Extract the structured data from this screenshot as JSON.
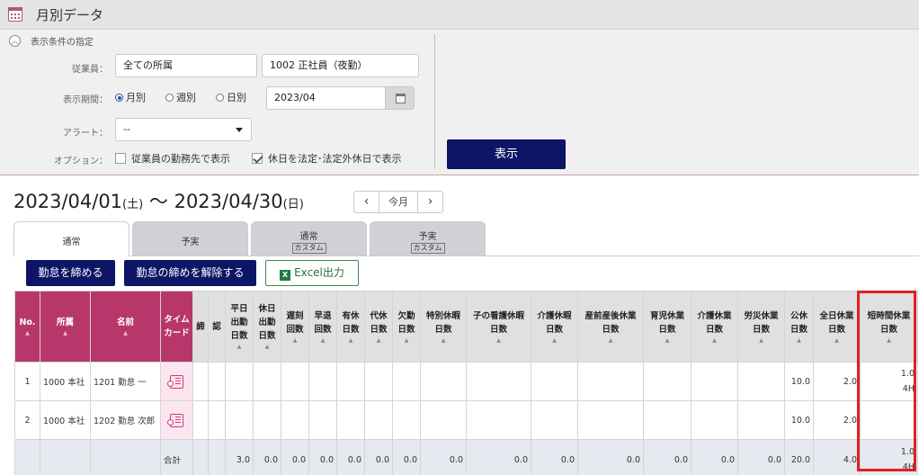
{
  "window": {
    "title": "月別データ"
  },
  "conditions": {
    "header": "表示条件の指定",
    "employee_label": "従業員：",
    "employee_dept": "全ての所属",
    "employee_name": "1002 正社員（夜勤）",
    "period_label": "表示期間：",
    "period_options": [
      "月別",
      "週別",
      "日別"
    ],
    "period_selected": "月別",
    "period_value": "2023/04",
    "alert_label": "アラート：",
    "alert_value": "--",
    "option_label": "オプション：",
    "option1": "従業員の勤務先で表示",
    "option1_checked": false,
    "option2": "休日を法定･法定外休日で表示",
    "option2_checked": true,
    "show_button": "表示"
  },
  "range": {
    "start": "2023/04/01",
    "start_day": "(土)",
    "sep": "〜",
    "end": "2023/04/30",
    "end_day": "(日)",
    "this_month": "今月",
    "prev": "‹",
    "next": "›"
  },
  "tabs": [
    {
      "label": "通常",
      "sub": "",
      "active": true
    },
    {
      "label": "予実",
      "sub": "",
      "active": false
    },
    {
      "label": "通常",
      "sub": "カスタム",
      "active": false
    },
    {
      "label": "予実",
      "sub": "カスタム",
      "active": false
    }
  ],
  "actions": {
    "close": "勤怠を締める",
    "unclose": "勤怠の締めを解除する",
    "excel": "Excel出力",
    "excel_icon": "X"
  },
  "table": {
    "columns": [
      {
        "name": "No.",
        "lines": [
          "No."
        ],
        "sort": true,
        "pink": true
      },
      {
        "name": "所属",
        "lines": [
          "所属"
        ],
        "sort": true,
        "pink": true
      },
      {
        "name": "名前",
        "lines": [
          "名前"
        ],
        "sort": true,
        "pink": true
      },
      {
        "name": "タイムカード",
        "lines": [
          "タイム",
          "カード"
        ],
        "sort": false,
        "pink": true
      },
      {
        "name": "締",
        "lines": [
          "締"
        ],
        "sort": false
      },
      {
        "name": "認",
        "lines": [
          "認"
        ],
        "sort": false
      },
      {
        "name": "平日出勤日数",
        "lines": [
          "平日",
          "出勤",
          "日数"
        ],
        "sort": true
      },
      {
        "name": "休日出勤日数",
        "lines": [
          "休日",
          "出勤",
          "日数"
        ],
        "sort": true
      },
      {
        "name": "遅刻回数",
        "lines": [
          "遅刻",
          "回数"
        ],
        "sort": true
      },
      {
        "name": "早退回数",
        "lines": [
          "早退",
          "回数"
        ],
        "sort": true
      },
      {
        "name": "有休日数",
        "lines": [
          "有休",
          "日数"
        ],
        "sort": true
      },
      {
        "name": "代休日数",
        "lines": [
          "代休",
          "日数"
        ],
        "sort": true
      },
      {
        "name": "欠勤日数",
        "lines": [
          "欠勤",
          "日数"
        ],
        "sort": true
      },
      {
        "name": "特別休暇日数",
        "lines": [
          "特別休暇",
          "日数"
        ],
        "sort": true
      },
      {
        "name": "子の看護休暇日数",
        "lines": [
          "子の看護休暇",
          "日数"
        ],
        "sort": true
      },
      {
        "name": "介護休暇日数",
        "lines": [
          "介護休暇",
          "日数"
        ],
        "sort": true
      },
      {
        "name": "産前産後休業日数",
        "lines": [
          "産前産後休業",
          "日数"
        ],
        "sort": true
      },
      {
        "name": "育児休業日数",
        "lines": [
          "育児休業",
          "日数"
        ],
        "sort": true
      },
      {
        "name": "介護休業日数",
        "lines": [
          "介護休業",
          "日数"
        ],
        "sort": true
      },
      {
        "name": "労災休業日数",
        "lines": [
          "労災休業",
          "日数"
        ],
        "sort": true
      },
      {
        "name": "公休日数",
        "lines": [
          "公休",
          "日数"
        ],
        "sort": true
      },
      {
        "name": "全日休業日数",
        "lines": [
          "全日休業",
          "日数"
        ],
        "sort": true
      },
      {
        "name": "短時間休業日数",
        "lines": [
          "短時間休業",
          "日数"
        ],
        "sort": true
      }
    ],
    "rows": [
      {
        "no": "1",
        "dept": "1000 本社",
        "name": "1201 勤怠 一",
        "timecard": true,
        "cells": [
          "",
          "",
          "",
          "",
          "",
          "",
          "",
          "",
          "",
          "",
          "",
          "",
          "",
          "",
          "",
          "",
          "10.0",
          "2.0",
          "1.0|4H"
        ]
      },
      {
        "no": "2",
        "dept": "1000 本社",
        "name": "1202 勤怠 次郎",
        "timecard": true,
        "cells": [
          "",
          "",
          "",
          "",
          "",
          "",
          "",
          "",
          "",
          "",
          "",
          "",
          "",
          "",
          "",
          "",
          "10.0",
          "2.0",
          ""
        ]
      }
    ],
    "total": {
      "label": "合計",
      "cells": [
        "",
        "",
        "3.0",
        "0.0",
        "0.0",
        "0.0",
        "0.0",
        "0.0",
        "0.0",
        "0.0",
        "0.0",
        "0.0",
        "0.0",
        "0.0",
        "0.0",
        "0.0",
        "20.0",
        "4.0",
        "1.0|4H"
      ]
    }
  },
  "colors": {
    "brand_pink": "#b8376a",
    "navy_button": "#0d1566",
    "highlight_red": "#e02020"
  }
}
